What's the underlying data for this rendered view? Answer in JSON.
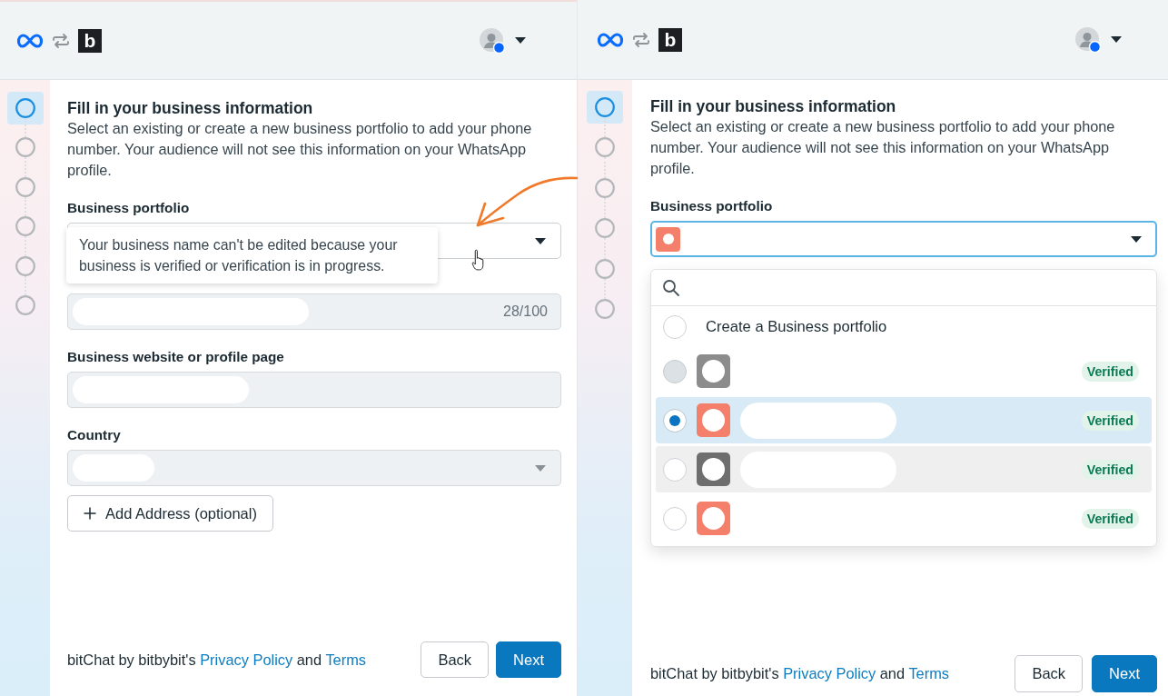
{
  "panels": [
    {
      "header": {
        "app_logo": "b"
      },
      "steps": [
        {
          "selected": true
        },
        {
          "selected": false
        },
        {
          "selected": false
        },
        {
          "selected": false
        },
        {
          "selected": false
        },
        {
          "selected": false
        }
      ],
      "title": "Fill in your business information",
      "description": "Select an existing or create a new business portfolio to add your phone number. Your audience will not see this information on your WhatsApp profile.",
      "fields": [
        {
          "kind": "select",
          "label": "Business portfolio",
          "disabled": false,
          "focused": false,
          "tooltip": "Your business name can't be edited because your business is verified or verification is in progress."
        },
        {
          "kind": "text",
          "disabled": true,
          "focused": false,
          "counter": "28/100"
        },
        {
          "kind": "text",
          "label": "Business website or profile page",
          "disabled": true,
          "focused": false
        },
        {
          "kind": "select",
          "label": "Country",
          "disabled": true,
          "focused": false
        }
      ],
      "add_button": "Add Address (optional)",
      "legal": [
        {
          "kind": "text",
          "text": "bitChat by bitbybit's"
        },
        {
          "kind": "link",
          "text": "Privacy Policy"
        },
        {
          "kind": "text",
          "text": "and"
        },
        {
          "kind": "link",
          "text": "Terms"
        }
      ],
      "buttons": [
        {
          "kind": "back",
          "label": "Back"
        },
        {
          "kind": "next",
          "label": "Next"
        }
      ]
    },
    {
      "header": {
        "app_logo": "b"
      },
      "steps": [
        {
          "selected": true
        },
        {
          "selected": false
        },
        {
          "selected": false
        },
        {
          "selected": false
        },
        {
          "selected": false
        },
        {
          "selected": false
        }
      ],
      "title": "Fill in your business information",
      "description": "Select an existing or create a new business portfolio to add your phone number. Your audience will not see this information on your WhatsApp profile.",
      "fields": [
        {
          "kind": "select",
          "label": "Business portfolio",
          "disabled": false,
          "focused": true,
          "menu": {
            "options": [
              {
                "kind": "create",
                "label": "Create a Business portfolio",
                "selected": false,
                "disabled": false,
                "highlighted": false
              },
              {
                "kind": "portfolio",
                "color": "#8c8c8c",
                "badge": "Verified",
                "selected": false,
                "disabled": true,
                "highlighted": false
              },
              {
                "kind": "portfolio",
                "color": "#f4806c",
                "badge": "Verified",
                "selected": true,
                "disabled": false,
                "highlighted": false
              },
              {
                "kind": "portfolio",
                "color": "#6e6e6e",
                "badge": "Verified",
                "selected": false,
                "disabled": false,
                "highlighted": true
              },
              {
                "kind": "portfolio",
                "color": "#f4806c",
                "badge": "Verified",
                "selected": false,
                "disabled": false,
                "highlighted": false
              }
            ]
          }
        }
      ],
      "legal": [
        {
          "kind": "text",
          "text": "bitChat by bitbybit's"
        },
        {
          "kind": "link",
          "text": "Privacy Policy"
        },
        {
          "kind": "text",
          "text": "and"
        },
        {
          "kind": "link",
          "text": "Terms"
        }
      ],
      "buttons": [
        {
          "kind": "back",
          "label": "Back"
        },
        {
          "kind": "next",
          "label": "Next"
        }
      ]
    }
  ]
}
